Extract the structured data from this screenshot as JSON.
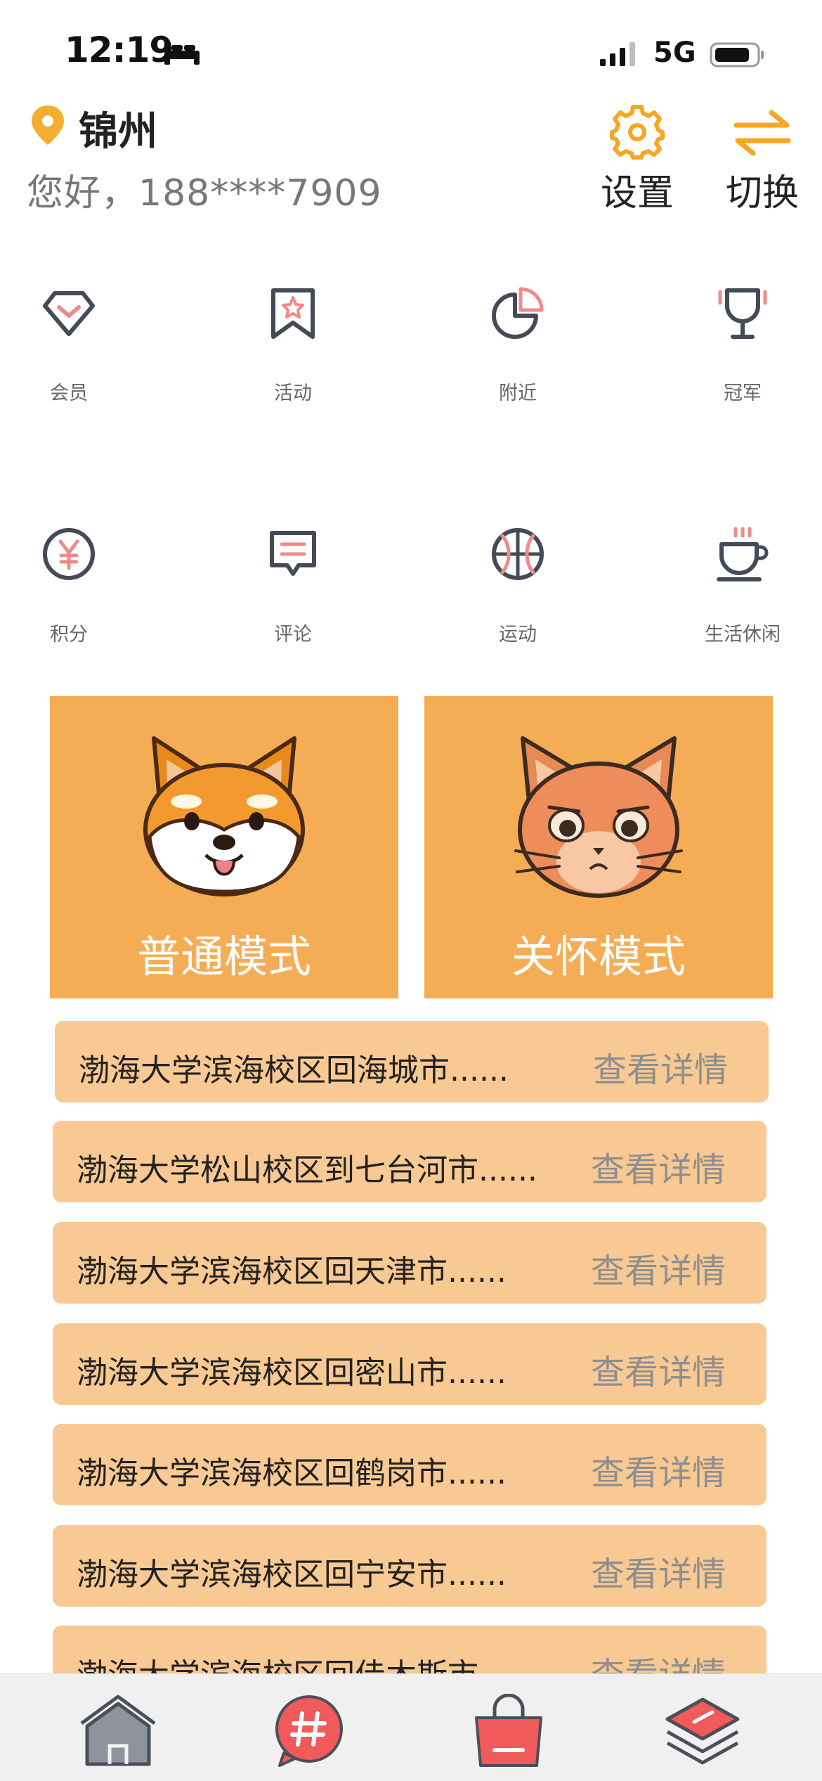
{
  "status_bar": {
    "time": "12:19",
    "network": "5G",
    "icons": [
      "sleep-icon",
      "signal-icon",
      "battery-icon"
    ]
  },
  "header": {
    "city": "锦州",
    "greeting": "您好，188****7909",
    "settings_label": "设置",
    "switch_label": "切换"
  },
  "quick_menu": [
    {
      "label": "会员",
      "icon": "diamond-icon"
    },
    {
      "label": "活动",
      "icon": "bookmark-star-icon"
    },
    {
      "label": "附近",
      "icon": "pie-icon"
    },
    {
      "label": "冠军",
      "icon": "trophy-icon"
    },
    {
      "label": "积分",
      "icon": "yen-coin-icon"
    },
    {
      "label": "评论",
      "icon": "comment-icon"
    },
    {
      "label": "运动",
      "icon": "basketball-icon"
    },
    {
      "label": "生活休闲",
      "icon": "coffee-cup-icon"
    }
  ],
  "modes": [
    {
      "label": "普通模式",
      "icon": "shiba-dog-icon"
    },
    {
      "label": "关怀模式",
      "icon": "cat-icon"
    }
  ],
  "routes": [
    {
      "title": "渤海大学滨海校区回海城市......",
      "action": "查看详情"
    },
    {
      "title": "渤海大学松山校区到七台河市......",
      "action": "查看详情"
    },
    {
      "title": "渤海大学滨海校区回天津市......",
      "action": "查看详情"
    },
    {
      "title": "渤海大学滨海校区回密山市......",
      "action": "查看详情"
    },
    {
      "title": "渤海大学滨海校区回鹤岗市......",
      "action": "查看详情"
    },
    {
      "title": "渤海大学滨海校区回宁安市......",
      "action": "查看详情"
    },
    {
      "title": "渤海大学滨海校区回佳木斯市......",
      "action": "查看详情"
    }
  ],
  "tabbar": [
    "home-icon",
    "hashtag-icon",
    "shopping-bag-icon",
    "layers-icon"
  ],
  "colors": {
    "accent": "#f5ad55",
    "row": "#f8c993",
    "pink": "#f08a8a",
    "red": "#f05a5a"
  }
}
